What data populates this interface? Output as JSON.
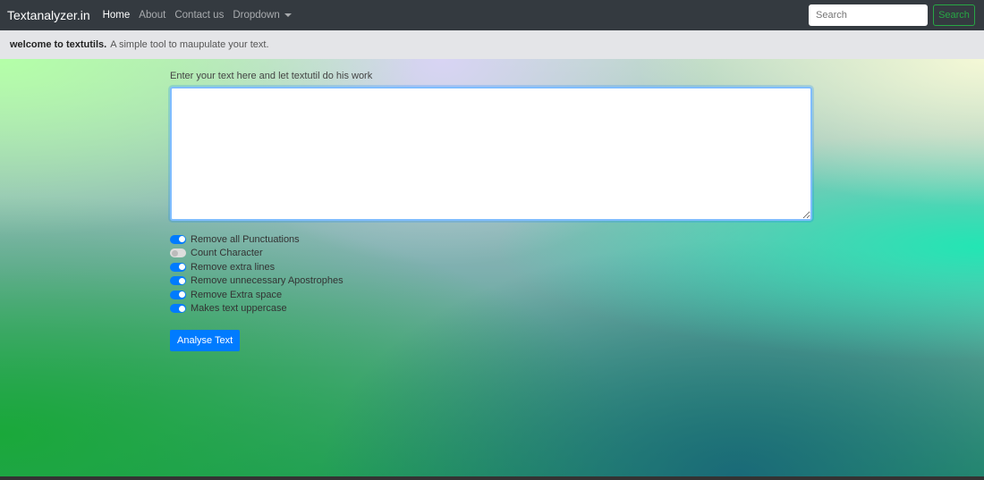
{
  "nav": {
    "brand": "Textanalyzer.in",
    "links": [
      "Home",
      "About",
      "Contact us",
      "Dropdown"
    ],
    "search_placeholder": "Search",
    "search_button": "Search"
  },
  "alert": {
    "bold": "welcome to textutils.",
    "text": "A simple tool to maupulate your text."
  },
  "form": {
    "label": "Enter your text here and let textutil do his work",
    "text_value": "",
    "options": [
      {
        "label": "Remove all Punctuations",
        "on": true
      },
      {
        "label": "Count Character",
        "on": false
      },
      {
        "label": "Remove extra lines",
        "on": true
      },
      {
        "label": "Remove unnecessary Apostrophes",
        "on": true
      },
      {
        "label": "Remove Extra space",
        "on": true
      },
      {
        "label": "Makes text uppercase",
        "on": true
      }
    ],
    "submit": "Analyse Text"
  }
}
